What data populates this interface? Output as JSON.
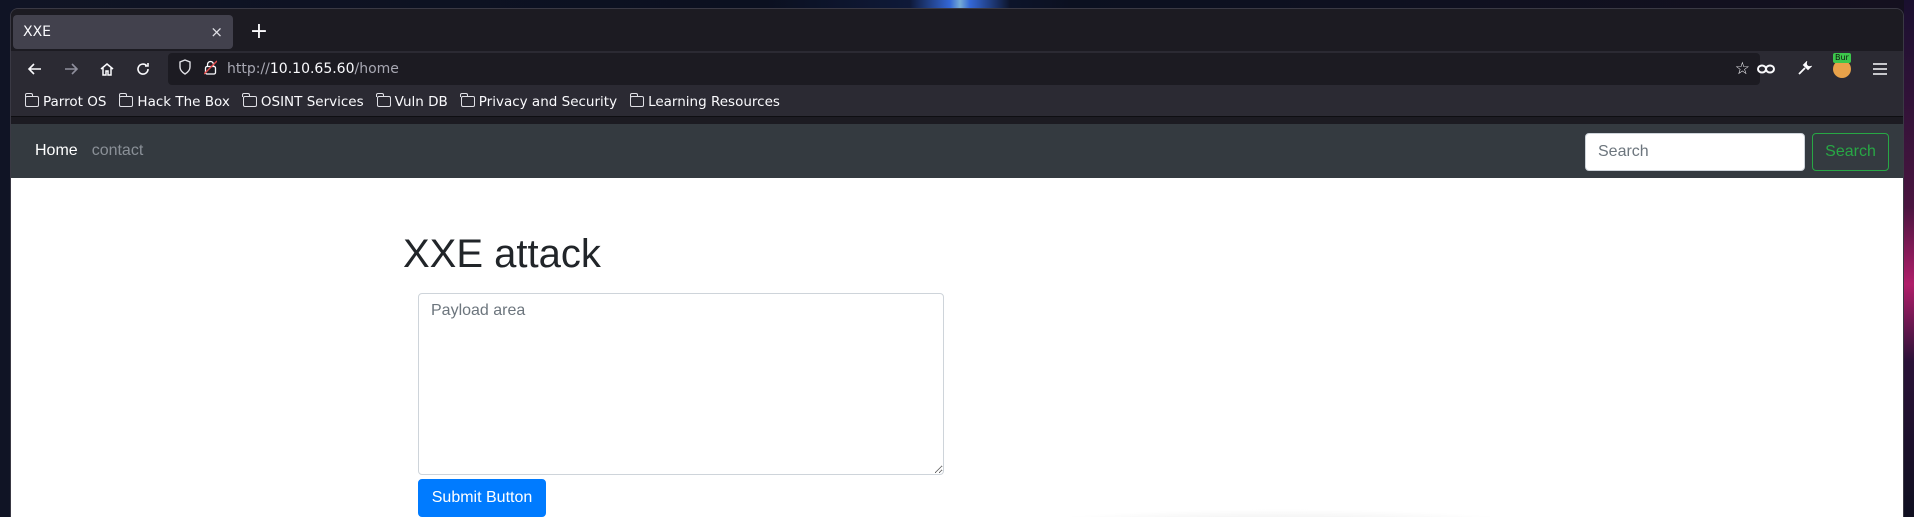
{
  "browser": {
    "tab": {
      "title": "XXE",
      "close": "×"
    },
    "new_tab": "+",
    "url": {
      "protocol": "http://",
      "host": "10.10.65.60",
      "path": "/home"
    },
    "burp_badge": "Bur",
    "bookmarks": [
      {
        "label": "Parrot OS"
      },
      {
        "label": "Hack The Box"
      },
      {
        "label": "OSINT Services"
      },
      {
        "label": "Vuln DB"
      },
      {
        "label": "Privacy and Security"
      },
      {
        "label": "Learning Resources"
      }
    ]
  },
  "site": {
    "nav": {
      "home": "Home",
      "contact": "contact"
    },
    "search": {
      "placeholder": "Search",
      "button": "Search"
    },
    "title": "XXE attack",
    "payload": {
      "placeholder": "Payload area"
    },
    "submit": "Submit Button"
  },
  "colors": {
    "site_navbar": "#343a40",
    "primary_button": "#007bff",
    "search_outline": "#28a745"
  },
  "icons": [
    "back-icon",
    "forward-icon",
    "home-icon",
    "reload-icon",
    "shield-icon",
    "insecure-lock-icon",
    "star-icon",
    "mask-icon",
    "wrench-icon",
    "burp-icon",
    "menu-icon",
    "folder-icon"
  ]
}
